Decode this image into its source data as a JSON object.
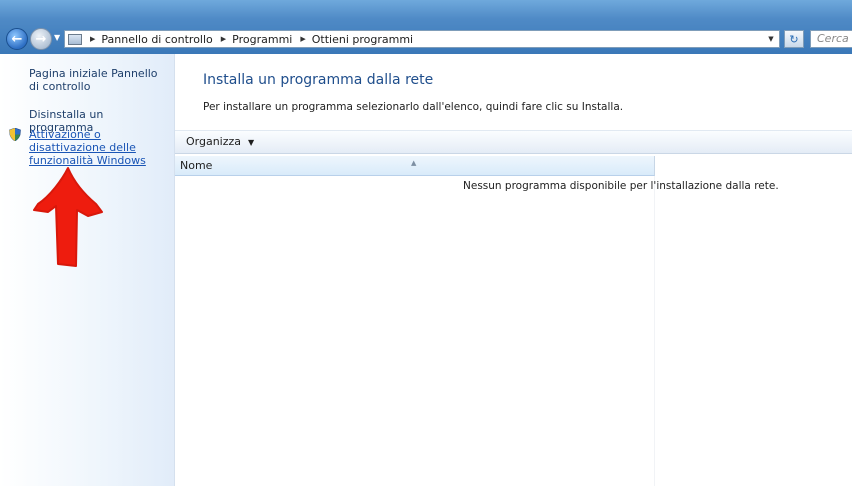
{
  "navigation": {
    "breadcrumbs": [
      "Pannello di controllo",
      "Programmi",
      "Ottieni programmi"
    ],
    "search_placeholder": "Cerca O"
  },
  "sidebar": {
    "items": [
      {
        "label": "Pagina iniziale Pannello di controllo"
      },
      {
        "label": "Disinstalla un programma"
      },
      {
        "label": "Attivazione o disattivazione delle funzionalità Windows"
      }
    ]
  },
  "main": {
    "title": "Installa un programma dalla rete",
    "description": "Per installare un programma selezionarlo dall'elenco, quindi fare clic su Installa.",
    "toolbar": {
      "organize_label": "Organizza"
    },
    "columns": [
      {
        "label": "Nome"
      }
    ],
    "empty_message": "Nessun programma disponibile per l'installazione dalla rete."
  },
  "colors": {
    "titlebar": "#4f8ac6",
    "link": "#1a55b5",
    "title": "#1f4e8c",
    "annotation_arrow": "#ee1c0e"
  },
  "icons": [
    "back-arrow-icon",
    "forward-arrow-icon",
    "control-panel-icon",
    "refresh-icon",
    "shield-icon",
    "red-arrow-annotation"
  ]
}
